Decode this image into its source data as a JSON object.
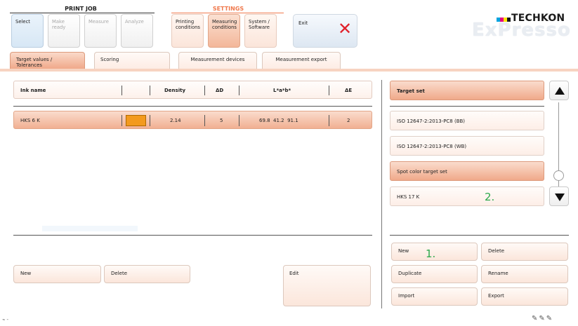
{
  "nav": {
    "print_job_title": "PRINT JOB",
    "settings_title": "SETTINGS",
    "print_job_buttons": [
      "Select",
      "Make ready",
      "Measure",
      "Analyze"
    ],
    "settings_buttons": [
      {
        "line1": "Printing",
        "line2": "conditions"
      },
      {
        "line1": "Measuring",
        "line2": "conditions"
      },
      {
        "line1": "System /",
        "line2": "Software"
      }
    ],
    "exit_label": "Exit"
  },
  "logo": {
    "brand": "TECHKON",
    "product": "ExPresso",
    "colors": [
      "#00a3e0",
      "#e6007e",
      "#ffe600",
      "#1a1a1a"
    ]
  },
  "tabs": [
    "Target values / Tolerances",
    "Scoring",
    "Measurement devices",
    "Measurement export"
  ],
  "ink_table": {
    "headers": {
      "ink_name": "Ink name",
      "density": "Density",
      "delta_d": "ΔD",
      "lab": "L*a*b*",
      "delta_e": "ΔE"
    },
    "rows": [
      {
        "ink_name": "HKS 6 K",
        "swatch_color": "#f39a1e",
        "density": "2.14",
        "delta_d": "5",
        "lab": "69.8  41.2  91.1",
        "delta_e": "2"
      }
    ]
  },
  "left_buttons": {
    "new": "New",
    "delete": "Delete",
    "edit": "Edit"
  },
  "target_sets": {
    "header": "Target set",
    "items": [
      "ISO 12647-2:2013-PC8 (BB)",
      "ISO 12647-2:2013-PC8 (WB)",
      "Spot color target set",
      "HKS 17 K"
    ],
    "selected_index": 2
  },
  "right_buttons": {
    "new": "New",
    "delete": "Delete",
    "duplicate": "Duplicate",
    "rename": "Rename",
    "import": "Import",
    "export": "Export"
  },
  "annotations": [
    "1.",
    "2."
  ]
}
